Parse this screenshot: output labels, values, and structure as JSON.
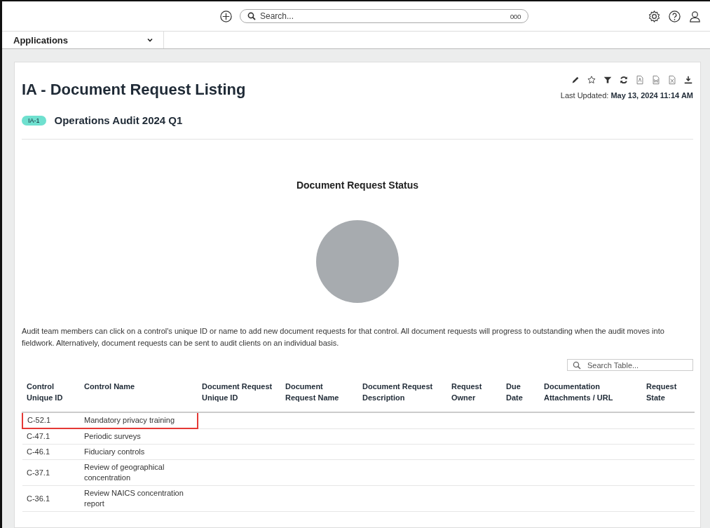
{
  "top_bar": {
    "search": {
      "placeholder": "Search..."
    },
    "more_label": "ooo"
  },
  "app_bar": {
    "label": "Applications"
  },
  "page": {
    "title": "IA - Document Request Listing",
    "last_updated": {
      "label": "Last Updated:",
      "value": "May 13, 2024 11:14 AM"
    },
    "badge": "IA-1",
    "subtitle": "Operations Audit 2024 Q1"
  },
  "chart": {
    "title": "Document Request Status"
  },
  "description": "Audit team members can click on a control's unique ID or name to add new document requests for that control. All document requests will progress to outstanding when the audit moves into fieldwork. Alternatively, document requests can be sent to audit clients on an individual basis.",
  "table": {
    "search": {
      "placeholder": "Search Table..."
    },
    "columns": [
      "Control Unique ID",
      "Control Name",
      "Document Request Unique ID",
      "Document Request Name",
      "Document Request Description",
      "Request Owner",
      "Due Date",
      "Documentation Attachments / URL",
      "Request State"
    ],
    "rows": [
      {
        "id": "C-52.1",
        "name": "Mandatory privacy training",
        "highlighted": true
      },
      {
        "id": "C-47.1",
        "name": "Periodic surveys",
        "highlighted": false
      },
      {
        "id": "C-46.1",
        "name": "Fiduciary controls",
        "highlighted": false
      },
      {
        "id": "C-37.1",
        "name": "Review of geographical concentration",
        "highlighted": false
      },
      {
        "id": "C-36.1",
        "name": "Review NAICS concentration report",
        "highlighted": false
      }
    ]
  }
}
